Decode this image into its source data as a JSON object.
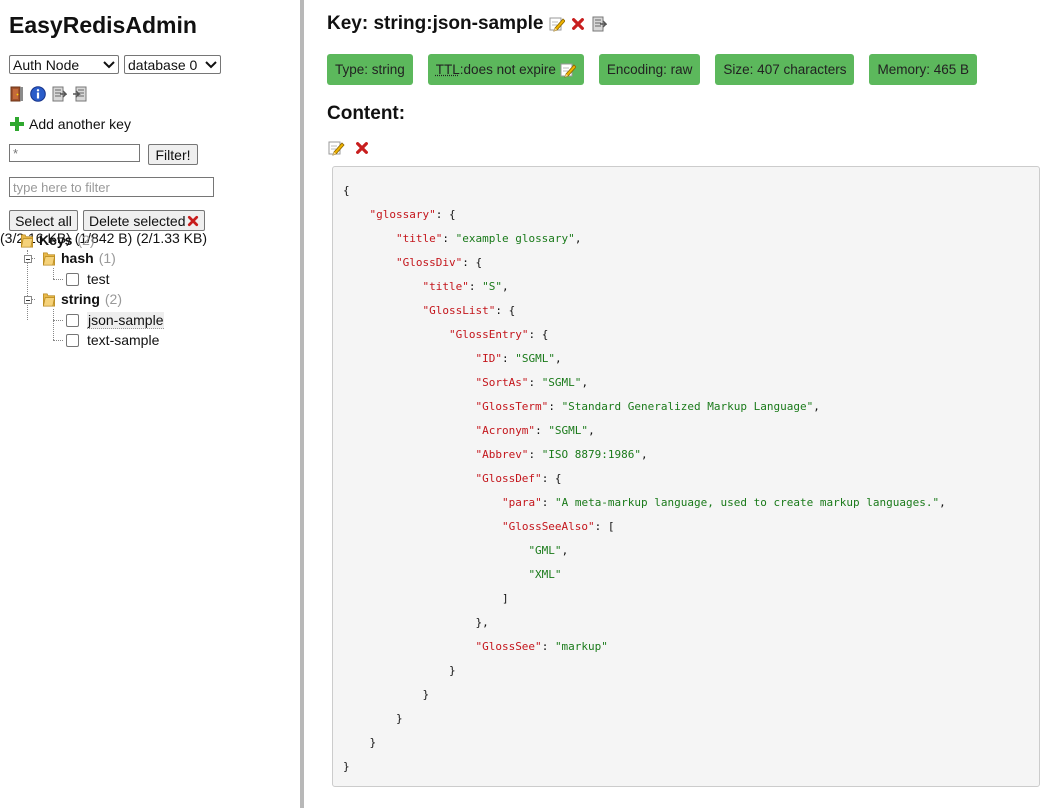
{
  "app": {
    "title": "EasyRedisAdmin"
  },
  "sidebar": {
    "node_select": {
      "selected": "Auth Node"
    },
    "db_select": {
      "selected": "database 0"
    },
    "toolbar_icons": [
      "logout-door-icon",
      "info-icon",
      "export-icon",
      "import-icon"
    ],
    "add_key_label": "Add another key",
    "pattern_input": {
      "placeholder": "*"
    },
    "filter_button": "Filter!",
    "type_filter": {
      "placeholder": "type here to filter"
    },
    "select_all_button": "Select all",
    "delete_selected_button": "Delete selected",
    "tree": {
      "root": {
        "label": "Keys",
        "count": "(2)",
        "size": "(3/2.16 KB)"
      },
      "groups": [
        {
          "label": "hash",
          "count": "(1)",
          "size": "(1/842 B)",
          "keys": [
            "test"
          ]
        },
        {
          "label": "string",
          "count": "(2)",
          "size": "(2/1.33 KB)",
          "keys": [
            "json-sample",
            "text-sample"
          ]
        }
      ]
    }
  },
  "main": {
    "key_title": "Key: string:json-sample",
    "badges": {
      "type": "Type: string",
      "ttl_abbr": "TTL",
      "ttl_rest": ":does not expire",
      "encoding": "Encoding: raw",
      "size": "Size: 407 characters",
      "memory": "Memory: 465 B"
    },
    "content_heading": "Content:",
    "json_lines": [
      [
        {
          "t": "p",
          "v": "{"
        }
      ],
      [
        {
          "t": "p",
          "v": "    "
        },
        {
          "t": "k",
          "v": "\"glossary\""
        },
        {
          "t": "p",
          "v": ": {"
        }
      ],
      [
        {
          "t": "p",
          "v": "        "
        },
        {
          "t": "k",
          "v": "\"title\""
        },
        {
          "t": "p",
          "v": ": "
        },
        {
          "t": "s",
          "v": "\"example glossary\""
        },
        {
          "t": "p",
          "v": ","
        }
      ],
      [
        {
          "t": "p",
          "v": "        "
        },
        {
          "t": "k",
          "v": "\"GlossDiv\""
        },
        {
          "t": "p",
          "v": ": {"
        }
      ],
      [
        {
          "t": "p",
          "v": "            "
        },
        {
          "t": "k",
          "v": "\"title\""
        },
        {
          "t": "p",
          "v": ": "
        },
        {
          "t": "s",
          "v": "\"S\""
        },
        {
          "t": "p",
          "v": ","
        }
      ],
      [
        {
          "t": "p",
          "v": "            "
        },
        {
          "t": "k",
          "v": "\"GlossList\""
        },
        {
          "t": "p",
          "v": ": {"
        }
      ],
      [
        {
          "t": "p",
          "v": "                "
        },
        {
          "t": "k",
          "v": "\"GlossEntry\""
        },
        {
          "t": "p",
          "v": ": {"
        }
      ],
      [
        {
          "t": "p",
          "v": "                    "
        },
        {
          "t": "k",
          "v": "\"ID\""
        },
        {
          "t": "p",
          "v": ": "
        },
        {
          "t": "s",
          "v": "\"SGML\""
        },
        {
          "t": "p",
          "v": ","
        }
      ],
      [
        {
          "t": "p",
          "v": "                    "
        },
        {
          "t": "k",
          "v": "\"SortAs\""
        },
        {
          "t": "p",
          "v": ": "
        },
        {
          "t": "s",
          "v": "\"SGML\""
        },
        {
          "t": "p",
          "v": ","
        }
      ],
      [
        {
          "t": "p",
          "v": "                    "
        },
        {
          "t": "k",
          "v": "\"GlossTerm\""
        },
        {
          "t": "p",
          "v": ": "
        },
        {
          "t": "s",
          "v": "\"Standard Generalized Markup Language\""
        },
        {
          "t": "p",
          "v": ","
        }
      ],
      [
        {
          "t": "p",
          "v": "                    "
        },
        {
          "t": "k",
          "v": "\"Acronym\""
        },
        {
          "t": "p",
          "v": ": "
        },
        {
          "t": "s",
          "v": "\"SGML\""
        },
        {
          "t": "p",
          "v": ","
        }
      ],
      [
        {
          "t": "p",
          "v": "                    "
        },
        {
          "t": "k",
          "v": "\"Abbrev\""
        },
        {
          "t": "p",
          "v": ": "
        },
        {
          "t": "s",
          "v": "\"ISO 8879:1986\""
        },
        {
          "t": "p",
          "v": ","
        }
      ],
      [
        {
          "t": "p",
          "v": "                    "
        },
        {
          "t": "k",
          "v": "\"GlossDef\""
        },
        {
          "t": "p",
          "v": ": {"
        }
      ],
      [
        {
          "t": "p",
          "v": "                        "
        },
        {
          "t": "k",
          "v": "\"para\""
        },
        {
          "t": "p",
          "v": ": "
        },
        {
          "t": "s",
          "v": "\"A meta-markup language, used to create markup languages.\""
        },
        {
          "t": "p",
          "v": ","
        }
      ],
      [
        {
          "t": "p",
          "v": "                        "
        },
        {
          "t": "k",
          "v": "\"GlossSeeAlso\""
        },
        {
          "t": "p",
          "v": ": ["
        }
      ],
      [
        {
          "t": "p",
          "v": "                            "
        },
        {
          "t": "s",
          "v": "\"GML\""
        },
        {
          "t": "p",
          "v": ","
        }
      ],
      [
        {
          "t": "p",
          "v": "                            "
        },
        {
          "t": "s",
          "v": "\"XML\""
        }
      ],
      [
        {
          "t": "p",
          "v": "                        ]"
        }
      ],
      [
        {
          "t": "p",
          "v": "                    },"
        }
      ],
      [
        {
          "t": "p",
          "v": "                    "
        },
        {
          "t": "k",
          "v": "\"GlossSee\""
        },
        {
          "t": "p",
          "v": ": "
        },
        {
          "t": "s",
          "v": "\"markup\""
        }
      ],
      [
        {
          "t": "p",
          "v": "                }"
        }
      ],
      [
        {
          "t": "p",
          "v": "            }"
        }
      ],
      [
        {
          "t": "p",
          "v": "        }"
        }
      ],
      [
        {
          "t": "p",
          "v": "    }"
        }
      ],
      [
        {
          "t": "p",
          "v": "}"
        }
      ]
    ]
  },
  "colors": {
    "badge_bg": "#5cb85c",
    "json_key": "#c4161c",
    "json_string": "#1a7a1a",
    "sidebar_border": "#b8b8b8"
  }
}
